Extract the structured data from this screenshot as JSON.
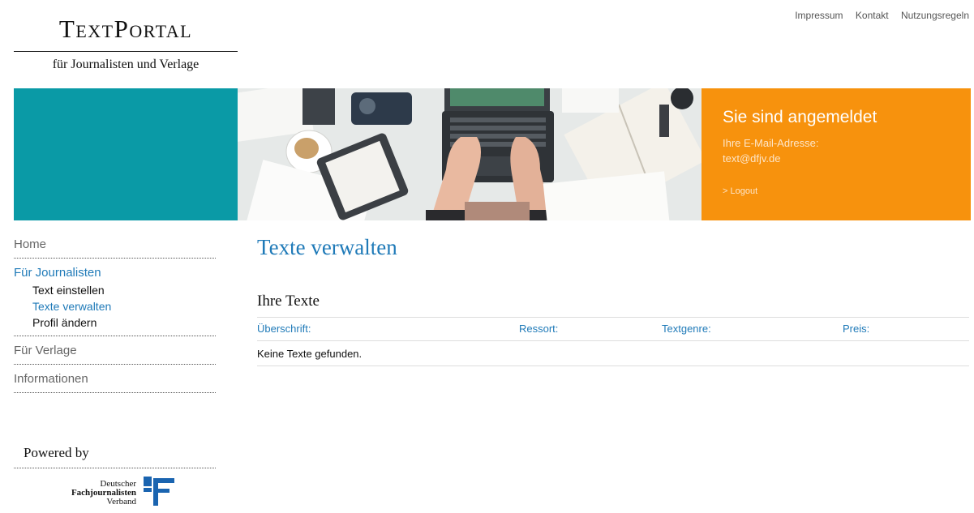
{
  "header": {
    "logo_title": "TextPortal",
    "logo_subtitle": "für Journalisten und Verlage",
    "topnav": [
      "Impressum",
      "Kontakt",
      "Nutzungsregeln"
    ]
  },
  "login": {
    "title": "Sie sind angemeldet",
    "email_label": "Ihre E-Mail-Adresse:",
    "email": "text@dfjv.de",
    "logout": "> Logout"
  },
  "sidebar": {
    "home": "Home",
    "section": {
      "title": "Für Journalisten",
      "items": [
        "Text einstellen",
        "Texte verwalten",
        "Profil ändern"
      ]
    },
    "verlage": "Für Verlage",
    "informationen": "Informationen",
    "powered_by": "Powered by",
    "partner": {
      "line1": "Deutscher",
      "line2": "Fachjournalisten",
      "line3": "Verband"
    }
  },
  "main": {
    "title": "Texte verwalten",
    "section_title": "Ihre Texte",
    "columns": [
      "Überschrift:",
      "Ressort:",
      "Textgenre:",
      "Preis:"
    ],
    "empty_message": "Keine Texte gefunden."
  },
  "colors": {
    "teal": "#0a9aa6",
    "orange": "#f7920d",
    "link_blue": "#1f7ab8"
  }
}
